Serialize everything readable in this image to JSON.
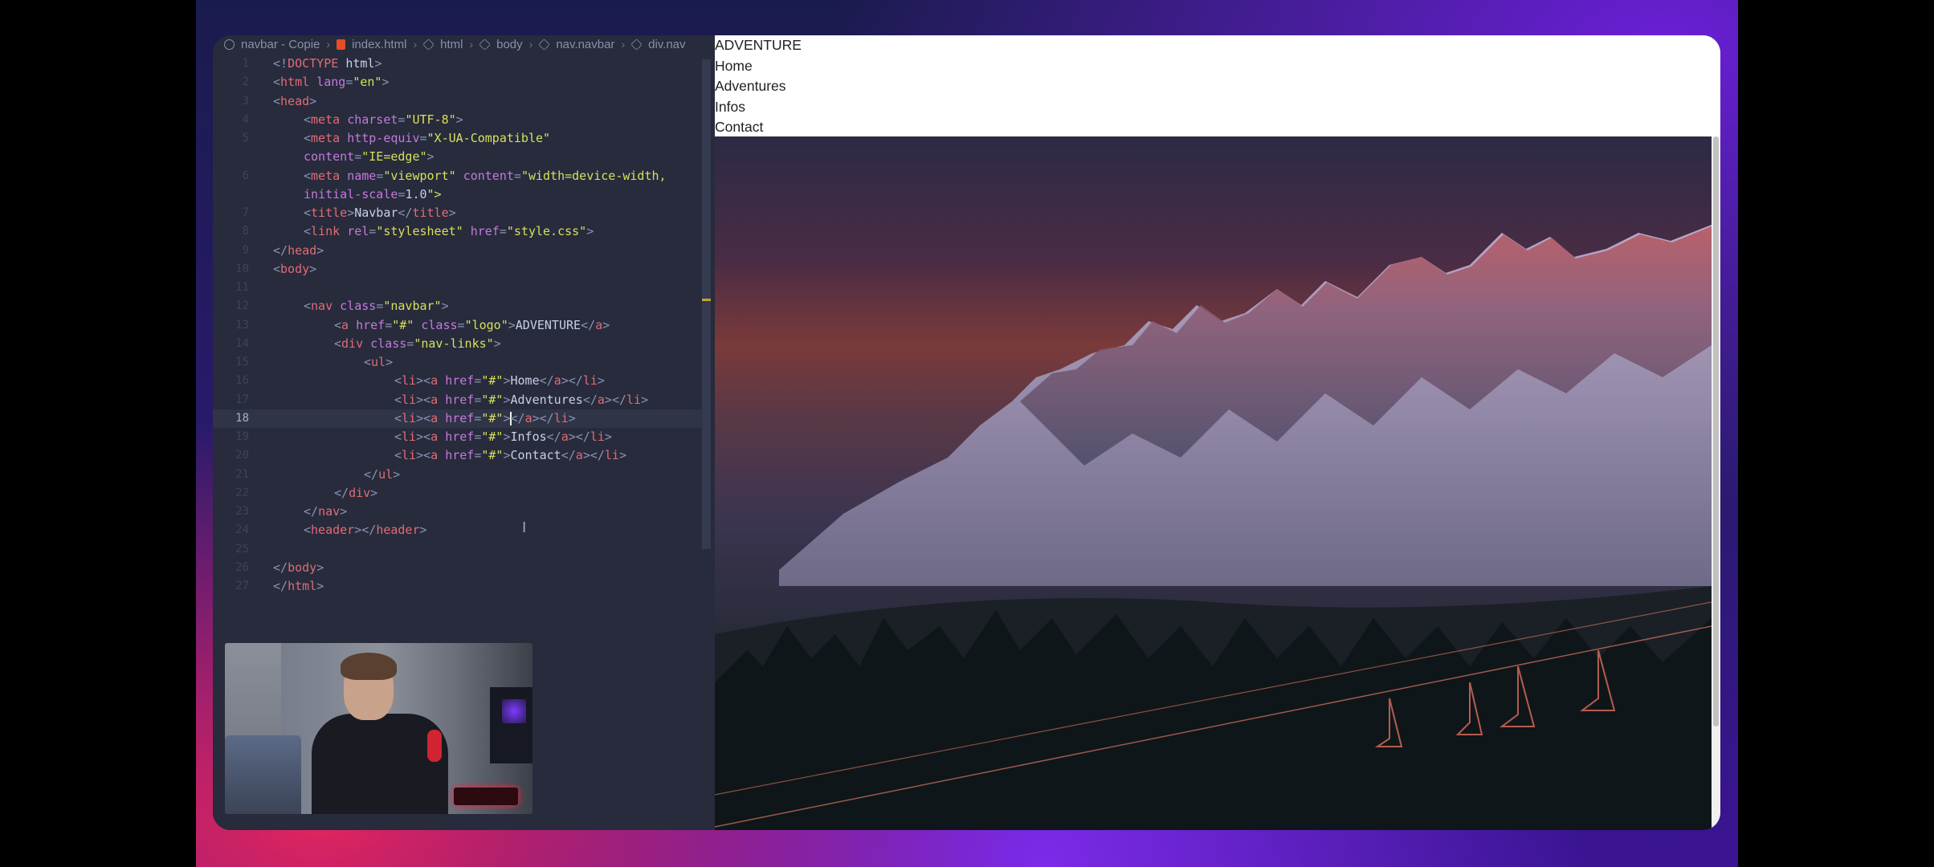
{
  "breadcrumb": [
    "navbar - Copie",
    "index.html",
    "html",
    "body",
    "nav.navbar",
    "div.nav"
  ],
  "editor": {
    "active_line": "18",
    "line_numbers": [
      "1",
      "2",
      "3",
      "4",
      "5",
      "6",
      "7",
      "8",
      "9",
      "10",
      "11",
      "12",
      "13",
      "14",
      "15",
      "16",
      "17",
      "18",
      "19",
      "20",
      "21",
      "22",
      "23",
      "24",
      "25",
      "26",
      "27"
    ],
    "lines": [
      "<!DOCTYPE html>",
      "<html lang=\"en\">",
      "<head>",
      "<meta charset=\"UTF-8\">",
      "<meta http-equiv=\"X-UA-Compatible\"",
      "content=\"IE=edge\">",
      "<meta name=\"viewport\" content=\"width=device-width,",
      "initial-scale=1.0\">",
      "<title>Navbar</title>",
      "<link rel=\"stylesheet\" href=\"style.css\">",
      "</head>",
      "<body>",
      "",
      "<nav class=\"navbar\">",
      "<a href=\"#\" class=\"logo\">ADVENTURE</a>",
      "<div class=\"nav-links\">",
      "<ul>",
      "<li><a href=\"#\">Home</a></li>",
      "<li><a href=\"#\">Adventures</a></li>",
      "<li><a href=\"#\"></a></li>",
      "<li><a href=\"#\">Infos</a></li>",
      "<li><a href=\"#\">Contact</a></li>",
      "</ul>",
      "</div>",
      "</nav>",
      "<header></header>",
      "",
      "</body>",
      "</html>"
    ]
  },
  "preview": {
    "logo": "ADVENTURE",
    "links": [
      "Home",
      "Adventures",
      "Infos",
      "Contact"
    ]
  },
  "colors": {
    "tag": "#e06c75",
    "attribute": "#c678dd",
    "string": "#d6e05a",
    "editor_bg": "#272b3c"
  },
  "icons": [
    "record-icon",
    "html5-icon",
    "element-icon",
    "chevron-right-icon",
    "text-cursor-icon"
  ]
}
